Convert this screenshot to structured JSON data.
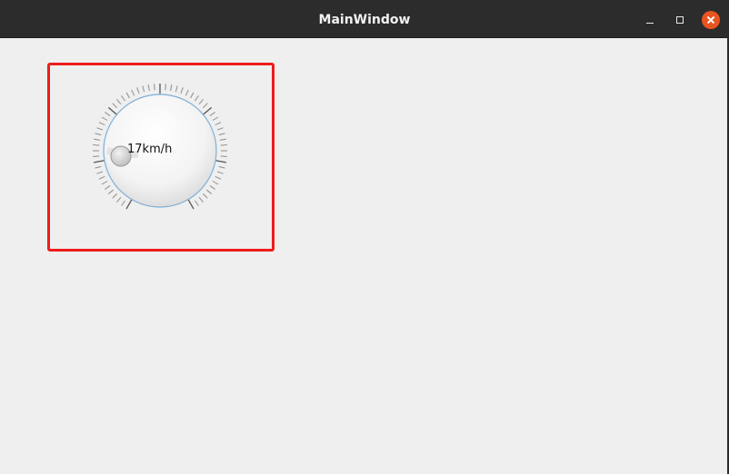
{
  "window": {
    "title": "MainWindow"
  },
  "dial": {
    "value": 17,
    "value_text": "17km/h",
    "unit": "km/h",
    "accent_color": "#7fb0d8",
    "highlight_color": "#ee1c1c"
  },
  "icons": {
    "minimize": "minimize-icon",
    "maximize": "maximize-icon",
    "close": "close-icon"
  }
}
